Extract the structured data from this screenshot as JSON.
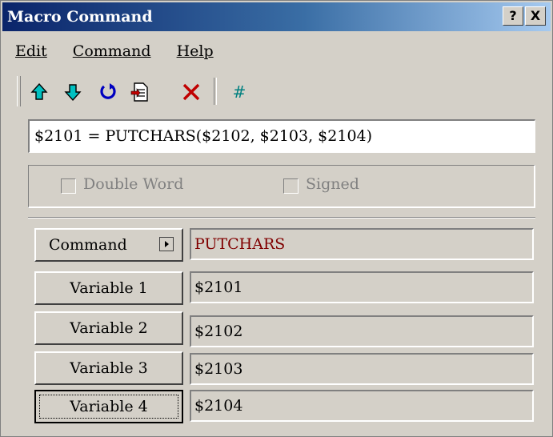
{
  "window": {
    "title": "Macro Command",
    "help_button": "?",
    "close_button": "X"
  },
  "menu": {
    "edit": "Edit",
    "command": "Command",
    "help": "Help"
  },
  "toolbar": {
    "icons": [
      "move-up-icon",
      "move-down-icon",
      "refresh-icon",
      "document-icon",
      "delete-icon",
      "hash-icon"
    ],
    "hash_label": "#"
  },
  "formula": {
    "value": "$2101 = PUTCHARS($2102, $2103, $2104)"
  },
  "options": {
    "double_word": {
      "label": "Double Word",
      "checked": false,
      "enabled": false
    },
    "signed": {
      "label": "Signed",
      "checked": false,
      "enabled": false
    }
  },
  "params": {
    "command": {
      "label": "Command",
      "value": "PUTCHARS"
    },
    "variable1": {
      "label": "Variable 1",
      "value": "$2101"
    },
    "variable2": {
      "label": "Variable 2",
      "value": "$2102"
    },
    "variable3": {
      "label": "Variable 3",
      "value": "$2103"
    },
    "variable4": {
      "label": "Variable 4",
      "value": "$2104"
    }
  },
  "colors": {
    "command_value": "#800000",
    "title_bar": "#0a246a"
  }
}
